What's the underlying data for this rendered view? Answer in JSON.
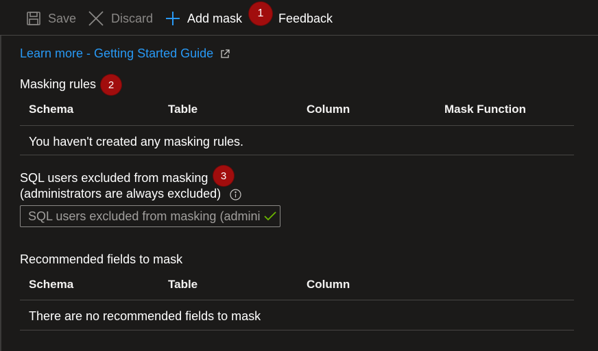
{
  "toolbar": {
    "save_label": "Save",
    "discard_label": "Discard",
    "add_mask_label": "Add mask",
    "feedback_label": "Feedback",
    "callout_1": "1"
  },
  "learn_more": {
    "label": "Learn more - Getting Started Guide"
  },
  "masking_rules": {
    "title": "Masking rules",
    "callout_2": "2",
    "columns": [
      "Schema",
      "Table",
      "Column",
      "Mask Function"
    ],
    "empty_message": "You haven't created any masking rules."
  },
  "excluded_users": {
    "label_line1": "SQL users excluded from masking",
    "label_line2": "(administrators are always excluded)",
    "callout_3": "3",
    "placeholder": "SQL users excluded from masking (admini...",
    "value": ""
  },
  "recommended": {
    "title": "Recommended fields to mask",
    "columns": [
      "Schema",
      "Table",
      "Column"
    ],
    "empty_message": "There are no recommended fields to mask"
  },
  "colors": {
    "background": "#1b1a19",
    "link": "#2899f5",
    "badge": "#a10d0d",
    "valid_check": "#6bb700"
  },
  "icons": {
    "save": "save-icon",
    "discard": "close-icon",
    "add": "plus-icon",
    "external": "external-link-icon",
    "info": "info-icon",
    "check": "checkmark-icon"
  }
}
